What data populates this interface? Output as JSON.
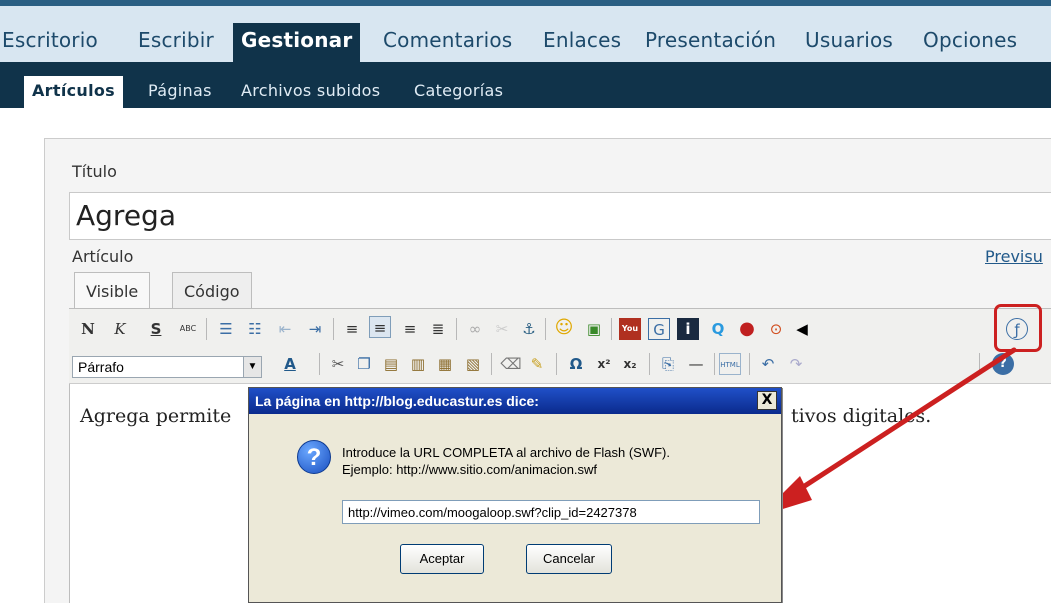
{
  "top_nav": [
    "Escritorio",
    "Escribir",
    "Gestionar",
    "Comentarios",
    "Enlaces",
    "Presentación",
    "Usuarios",
    "Opciones"
  ],
  "top_nav_active": "Gestionar",
  "sub_nav": [
    "Artículos",
    "Páginas",
    "Archivos subidos",
    "Categorías"
  ],
  "sub_nav_active": "Artículos",
  "form": {
    "title_label": "Título",
    "title_value": "Agrega",
    "article_label": "Artículo",
    "preview_link": "Previsu",
    "tabs": [
      "Visible",
      "Código"
    ]
  },
  "editor": {
    "format_select": "Párrafo",
    "text_left": "Agrega permite",
    "text_right": "tivos digitales.",
    "toolbar_row1_icons": [
      "bold-icon",
      "italic-icon",
      "strikethrough-icon",
      "spellcheck-icon",
      "bullet-list-icon",
      "numbered-list-icon",
      "outdent-icon",
      "indent-icon",
      "align-left-icon",
      "align-center-icon",
      "align-right-icon",
      "justify-icon",
      "link-icon",
      "unlink-icon",
      "anchor-icon",
      "emoticon-icon",
      "image-icon",
      "youtube-icon",
      "google-video-icon",
      "info-icon",
      "quicktime-icon",
      "record-icon",
      "media-play-icon",
      "audio-icon",
      "flash-icon"
    ],
    "toolbar_row2_icons": [
      "font-color-icon",
      "cut-icon",
      "copy-icon",
      "paste-icon",
      "paste-text-icon",
      "paste-word-icon",
      "paste-html-icon",
      "eraser-icon",
      "cleanup-icon",
      "special-char-icon",
      "superscript-icon",
      "subscript-icon",
      "page-break-icon",
      "horizontal-rule-icon",
      "html-icon",
      "undo-icon",
      "redo-icon",
      "help-icon"
    ]
  },
  "dialog": {
    "title": "La página en http://blog.educastur.es dice:",
    "close_label": "X",
    "icon": "question-icon",
    "message_line1": "Introduce la URL COMPLETA al archivo de Flash (SWF).",
    "message_line2": "Ejemplo: http://www.sitio.com/animacion.swf",
    "input_value": "http://vimeo.com/moogaloop.swf?clip_id=2427378",
    "ok_label": "Aceptar",
    "cancel_label": "Cancelar"
  },
  "colors": {
    "nav_dark": "#10334a",
    "nav_light": "#d8e6f1",
    "highlight_red": "#cc2020",
    "dialog_title_blue": "#0a2a8c"
  }
}
